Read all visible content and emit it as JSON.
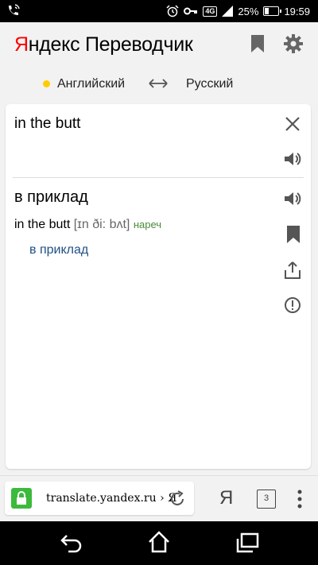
{
  "status_bar": {
    "battery_text": "25%",
    "battery_level": 0.25,
    "time": "19:59",
    "network": "4G",
    "icons": [
      "wifi-call-icon",
      "alarm-icon",
      "key-icon",
      "4g-icon",
      "signal-icon",
      "battery-icon"
    ]
  },
  "header": {
    "logo_first": "Я",
    "logo_second": "ндекс",
    "logo_third": " Переводчик",
    "brand_color": "#ff0000"
  },
  "languages": {
    "source": "Английский",
    "target": "Русский",
    "dot_color": "#ffcc00"
  },
  "input": {
    "text": "in the butt"
  },
  "result": {
    "translation": "в приклад",
    "dictionary": {
      "word": "in the butt",
      "transcription": "[ɪn ði: bʌt]",
      "part_of_speech": "нареч",
      "meaning": "в приклад"
    }
  },
  "browser": {
    "url": "translate.yandex.ru › Я",
    "ya_label": "Я",
    "tab_count": "3"
  }
}
